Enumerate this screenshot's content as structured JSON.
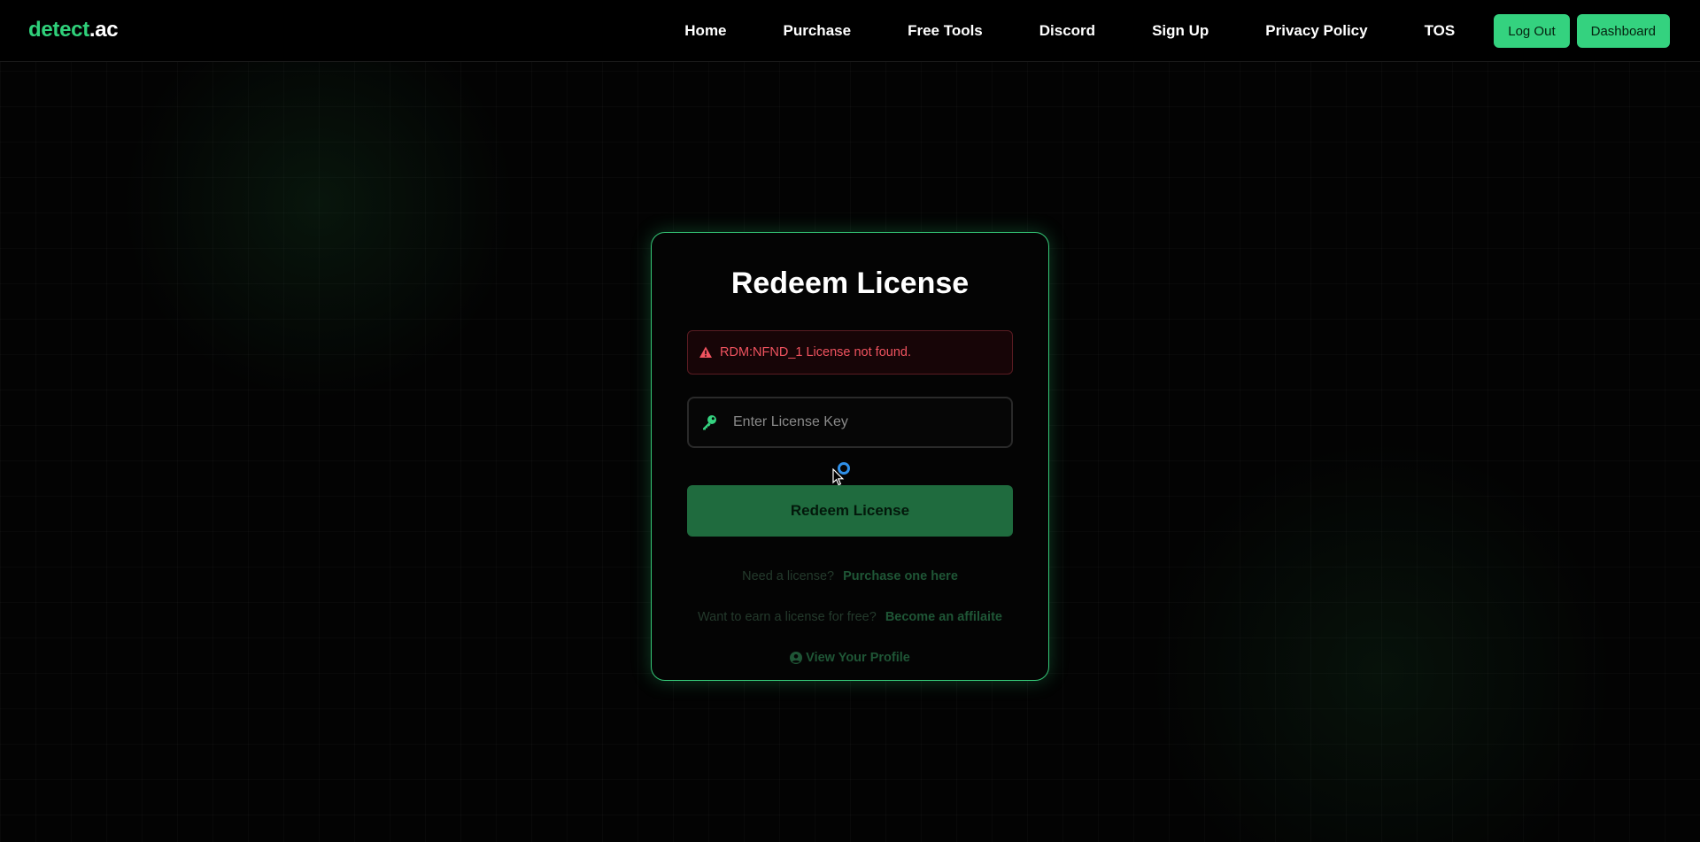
{
  "header": {
    "brand_part1": "detect",
    "brand_part2": ".ac",
    "nav": [
      {
        "label": "Home"
      },
      {
        "label": "Purchase"
      },
      {
        "label": "Free Tools"
      },
      {
        "label": "Discord"
      },
      {
        "label": "Sign Up"
      },
      {
        "label": "Privacy Policy"
      },
      {
        "label": "TOS"
      }
    ],
    "logout_label": "Log Out",
    "dashboard_label": "Dashboard"
  },
  "card": {
    "title": "Redeem License",
    "alert": {
      "icon": "warning-triangle-icon",
      "text": "RDM:NFND_1 License not found."
    },
    "license_input": {
      "icon": "key-icon",
      "value": "",
      "placeholder": "Enter License Key"
    },
    "redeem_button_label": "Redeem License",
    "need_license_text": "Need a license?",
    "purchase_link": "Purchase one here",
    "earn_text": "Want to earn a license for free?",
    "affiliate_link": "Become an affilaite",
    "profile_icon": "user-circle-icon",
    "profile_link": "View Your Profile"
  },
  "colors": {
    "accent": "#34d27f",
    "button_dark_green": "#1f6b3e",
    "error_text": "#f0535f",
    "card_border": "#35c877"
  }
}
